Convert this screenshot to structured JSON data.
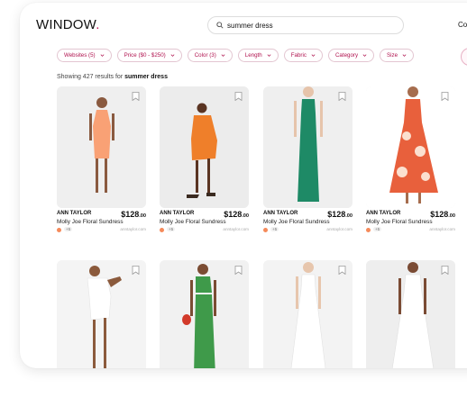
{
  "header": {
    "logo": "WINDOW",
    "logo_dot": ".",
    "search_query": "summer dress",
    "nav_partial": "Co"
  },
  "filters": [
    {
      "label": "Websites (5)"
    },
    {
      "label": "Price ($0 - $250)"
    },
    {
      "label": "Color (3)"
    },
    {
      "label": "Length"
    },
    {
      "label": "Fabric"
    },
    {
      "label": "Category"
    },
    {
      "label": "Size"
    }
  ],
  "results": {
    "prefix": "Showing 427 results for",
    "query": "summer dress"
  },
  "products": [
    {
      "brand": "ANN TAYLOR",
      "price_main": "$128",
      "price_cents": ".00",
      "title": "Molly Joe Floral Sundress",
      "more": "+5",
      "store": "anntaylor.com",
      "swatch": "#f58a5a",
      "dress": "#f9a175",
      "bg": "#efefef",
      "skin": "#8a5a40"
    },
    {
      "brand": "ANN TAYLOR",
      "price_main": "$128",
      "price_cents": ".00",
      "title": "Molly Joe Floral Sundress",
      "more": "+5",
      "store": "anntaylor.com",
      "swatch": "#f58a5a",
      "dress": "#ef7f2a",
      "bg": "#ececec",
      "skin": "#5a3422"
    },
    {
      "brand": "ANN TAYLOR",
      "price_main": "$128",
      "price_cents": ".00",
      "title": "Molly Joe Floral Sundress",
      "more": "+5",
      "store": "anntaylor.com",
      "swatch": "#f58a5a",
      "dress": "#1e8a66",
      "bg": "#efefef",
      "skin": "#e6c4ab"
    },
    {
      "brand": "ANN TAYLOR",
      "price_main": "$128",
      "price_cents": ".00",
      "title": "Molly Joe Floral Sundress",
      "more": "+5",
      "store": "anntaylor.com",
      "swatch": "#f58a5a",
      "dress": "#e8603c",
      "bg": "#ffffff",
      "skin": "#a66d4e"
    },
    {
      "brand": "",
      "price_main": "",
      "price_cents": "",
      "title": "",
      "more": "",
      "store": "",
      "swatch": "",
      "dress": "#ffffff",
      "bg": "#f4f4f4",
      "skin": "#8b5a3c"
    },
    {
      "brand": "",
      "price_main": "",
      "price_cents": "",
      "title": "",
      "more": "",
      "store": "",
      "swatch": "",
      "dress": "#3f9a4a",
      "bg": "#f1f1f1",
      "skin": "#7b4c33"
    },
    {
      "brand": "",
      "price_main": "",
      "price_cents": "",
      "title": "",
      "more": "",
      "store": "",
      "swatch": "",
      "dress": "#ffffff",
      "bg": "#f3f3f3",
      "skin": "#e7c6ad"
    },
    {
      "brand": "",
      "price_main": "",
      "price_cents": "",
      "title": "",
      "more": "",
      "store": "",
      "swatch": "",
      "dress": "#ffffff",
      "bg": "#eeeeee",
      "skin": "#7a4b34"
    }
  ]
}
